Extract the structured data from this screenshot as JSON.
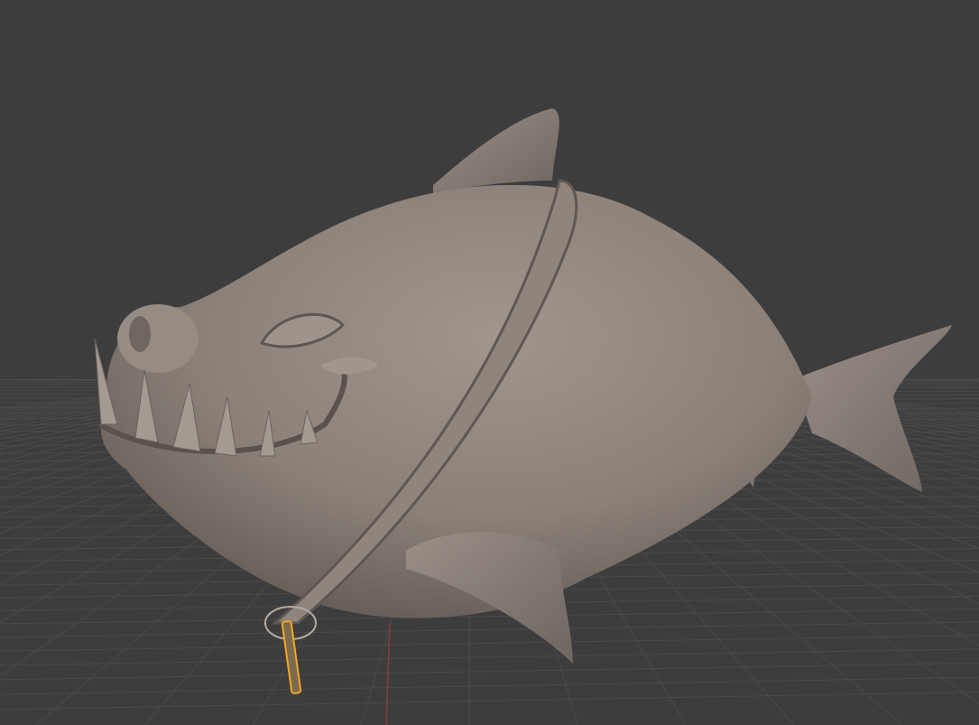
{
  "viewport": {
    "mode": "3d-viewport",
    "colors": {
      "background": "#3d3d3d",
      "grid": "#4a4a4a",
      "x_axis": "#8a3a42",
      "model": "#8c827a",
      "model_shadow": "#5e5650",
      "model_highlight": "#a59b93",
      "selection": "#f5a623"
    }
  }
}
